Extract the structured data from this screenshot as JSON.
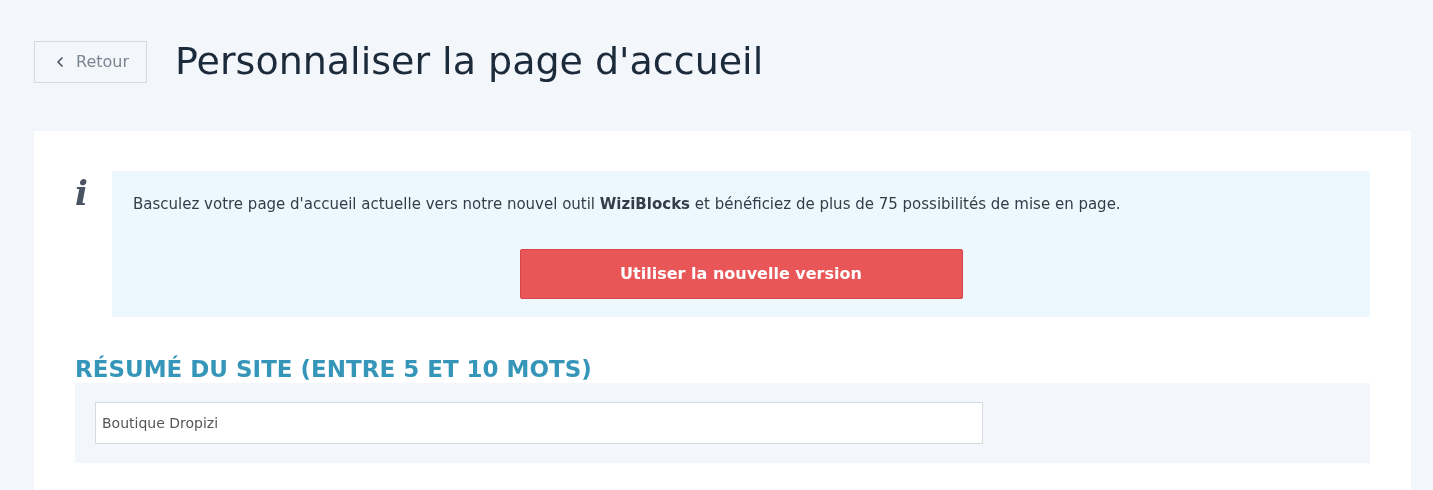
{
  "back_button": {
    "label": "Retour"
  },
  "page_title": "Personnaliser la page d'accueil",
  "info_box": {
    "icon": "i",
    "message": "Basculez votre page d'accueil actuelle vers notre nouvel outil **WiziBlocks** et bénéficiez de plus de 75 possibilités de mise en page.",
    "button": "Utiliser la nouvelle version"
  },
  "section": {
    "title": "RÉSUMÉ DU SITE (ENTRE 5 ET 10 MOTS)",
    "field_value": "Boutique Dropizi"
  }
}
